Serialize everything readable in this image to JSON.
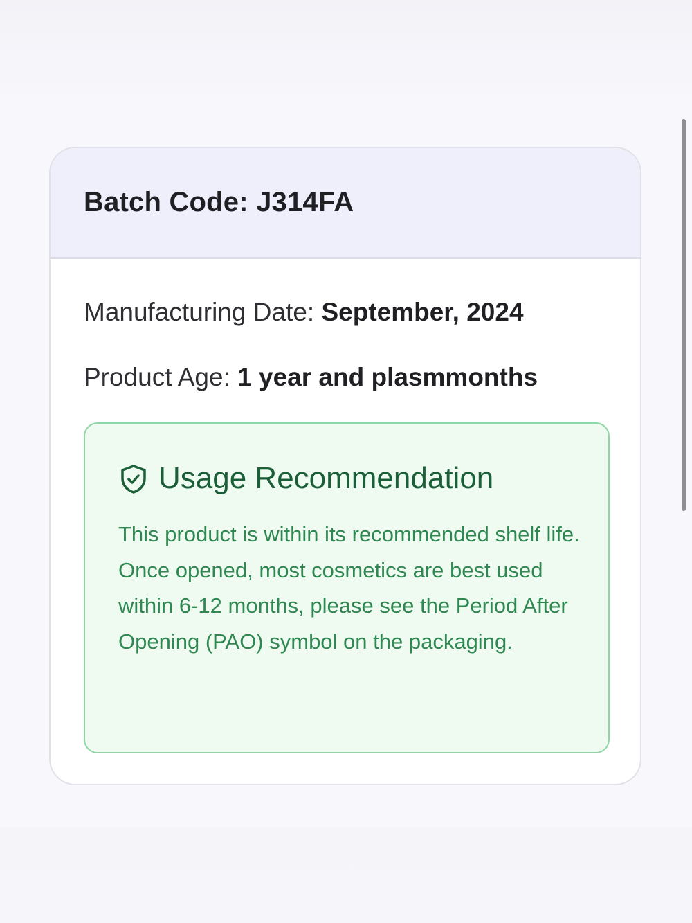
{
  "batch": {
    "label": "Batch Code:",
    "code": "J314FA",
    "title": "Batch Code: J314FA"
  },
  "details": {
    "manufacturing_label": "Manufacturing Date:",
    "manufacturing_value": "September, 2024",
    "age_label": "Product Age:",
    "age_value": "1 year and plasmmonths"
  },
  "recommendation": {
    "icon": "shield-check-icon",
    "title": "Usage Recommendation",
    "body": "This product is within its recommended shelf life. Once opened, most cosmetics are best used within 6-12 months, please see the Period After Opening (PAO) symbol on the packaging."
  },
  "colors": {
    "header_bg": "#efeffb",
    "recommendation_bg": "#effaf1",
    "recommendation_border": "#8ed7a4",
    "recommendation_title": "#1a5f37",
    "recommendation_text": "#2f8851"
  }
}
